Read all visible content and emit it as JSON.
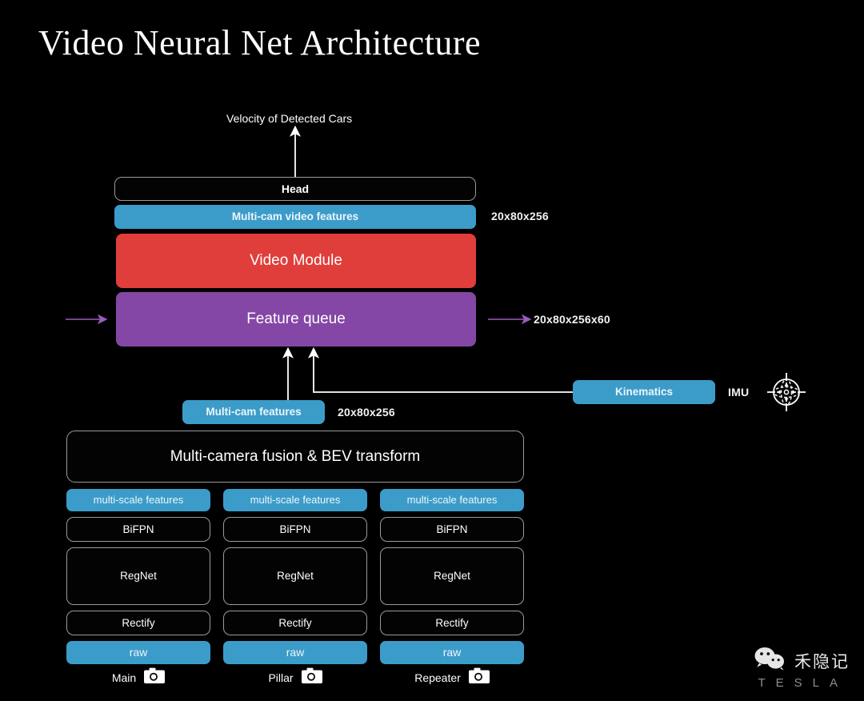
{
  "title": "Video Neural Net Architecture",
  "output": {
    "label": "Velocity of Detected Cars"
  },
  "head": {
    "label": "Head"
  },
  "multicam_video_features": {
    "label": "Multi-cam video features",
    "dim": "20x80x256"
  },
  "video_module": {
    "label": "Video Module"
  },
  "feature_queue": {
    "label": "Feature queue",
    "dim": "20x80x256x60"
  },
  "multicam_features": {
    "label": "Multi-cam features",
    "dim": "20x80x256"
  },
  "kinematics": {
    "label": "Kinematics",
    "imu_label": "IMU",
    "imu_icon": "gyroscope-icon"
  },
  "fusion": {
    "label": "Multi-camera fusion & BEV transform"
  },
  "backbones": [
    {
      "camera": "Main",
      "camera_icon": "camera-icon",
      "stages": [
        {
          "label": "multi-scale features",
          "style": "pill"
        },
        {
          "label": "BiFPN",
          "style": "outline"
        },
        {
          "label": "RegNet",
          "style": "outline"
        },
        {
          "label": "Rectify",
          "style": "outline"
        },
        {
          "label": "raw",
          "style": "pill"
        }
      ]
    },
    {
      "camera": "Pillar",
      "camera_icon": "camera-icon",
      "stages": [
        {
          "label": "multi-scale features",
          "style": "pill"
        },
        {
          "label": "BiFPN",
          "style": "outline"
        },
        {
          "label": "RegNet",
          "style": "outline"
        },
        {
          "label": "Rectify",
          "style": "outline"
        },
        {
          "label": "raw",
          "style": "pill"
        }
      ]
    },
    {
      "camera": "Repeater",
      "camera_icon": "camera-icon",
      "stages": [
        {
          "label": "multi-scale features",
          "style": "pill"
        },
        {
          "label": "BiFPN",
          "style": "outline"
        },
        {
          "label": "RegNet",
          "style": "outline"
        },
        {
          "label": "Rectify",
          "style": "outline"
        },
        {
          "label": "raw",
          "style": "pill"
        }
      ]
    }
  ],
  "watermark": {
    "wechat_icon": "wechat-icon",
    "account": "禾隐记",
    "brand": "TESLA"
  },
  "colors": {
    "background": "#000000",
    "blue": "#3c9cc9",
    "red": "#e03e3b",
    "purple": "#8447a6",
    "outline": "#9a9a9a",
    "arrow_white": "#ffffff",
    "arrow_purple": "#9b5bbf"
  }
}
